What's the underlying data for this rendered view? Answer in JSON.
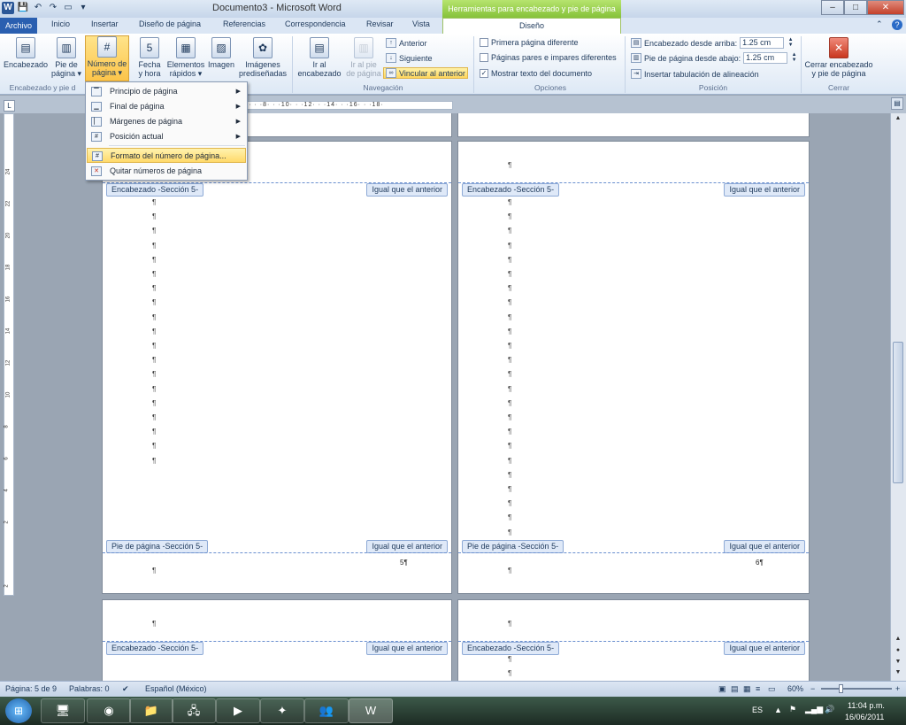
{
  "window": {
    "title": "Documento3 - Microsoft Word",
    "context_tab": "Herramientas para encabezado y pie de página",
    "minimize": "–",
    "maximize": "□",
    "close": "✕",
    "qa_icons": {
      "word": "W",
      "save": "💾",
      "undo": "↶",
      "redo": "↷",
      "print": "▭",
      "custom": "▾"
    }
  },
  "tabs": {
    "archivo": "Archivo",
    "inicio": "Inicio",
    "insertar": "Insertar",
    "diseno_pagina": "Diseño de página",
    "referencias": "Referencias",
    "correspondencia": "Correspondencia",
    "revisar": "Revisar",
    "vista": "Vista",
    "diseno": "Diseño",
    "minimize_ribbon": "⌃",
    "help": "?"
  },
  "ribbon": {
    "encabezado": "Encabezado",
    "pie_pagina_1": "Pie de",
    "pie_pagina_2": "página ▾",
    "numero_pagina_1": "Número de",
    "numero_pagina_2": "página ▾",
    "fecha_1": "Fecha",
    "fecha_2": "y hora",
    "elementos_1": "Elementos",
    "elementos_2": "rápidos ▾",
    "imagen": "Imagen",
    "imagenes_pred_1": "Imágenes",
    "imagenes_pred_2": "prediseñadas",
    "ir_encabezado_1": "Ir al",
    "ir_encabezado_2": "encabezado",
    "ir_pie_1": "Ir al pie",
    "ir_pie_2": "de página",
    "anterior": "Anterior",
    "siguiente": "Siguiente",
    "vincular": "Vincular al anterior",
    "primera_pagina": "Primera página diferente",
    "pares_impares": "Páginas pares e impares diferentes",
    "mostrar_texto": "Mostrar texto del documento",
    "enc_arriba_label": "Encabezado desde arriba:",
    "enc_arriba_value": "1.25 cm",
    "pie_abajo_label": "Pie de página desde abajo:",
    "pie_abajo_value": "1.25 cm",
    "tab_alineacion": "Insertar tabulación de alineación",
    "cerrar_1": "Cerrar encabezado",
    "cerrar_2": "y pie de página",
    "groups": {
      "encabezado": "Encabezado y pie d",
      "navegacion": "Navegación",
      "opciones": "Opciones",
      "posicion": "Posición",
      "cerrar": "Cerrar"
    },
    "checks": {
      "primera": false,
      "pares": false,
      "mostrar": true
    }
  },
  "menu": {
    "items": [
      {
        "label": "Principio de página",
        "submenu": true
      },
      {
        "label": "Final de página",
        "submenu": true
      },
      {
        "label": "Márgenes de página",
        "submenu": true
      },
      {
        "label": "Posición actual",
        "submenu": true
      },
      {
        "label": "Formato del número de página...",
        "submenu": false
      },
      {
        "label": "Quitar números de página",
        "submenu": false
      }
    ]
  },
  "ruler": {
    "horizontal": "·5·  · ·8·  · ·10· ·  ·12·  · ·14· ·  ·16·  · ·18·",
    "vertical": [
      "24",
      "22",
      "20",
      "18",
      "16",
      "14",
      "12",
      "10",
      "8",
      "6",
      "4",
      "2",
      "2"
    ]
  },
  "pages": {
    "header_tag": "Encabezado -Sección 5-",
    "footer_tag": "Pie de página -Sección 5-",
    "same_as_previous": "Igual que el anterior",
    "pilcrow": "¶",
    "page5_number": "5¶",
    "page6_number": "6¶"
  },
  "status": {
    "page": "Página: 5 de 9",
    "words": "Palabras: 0",
    "language": "Español (México)",
    "zoom": "60%",
    "zoom_minus": "−",
    "zoom_plus": "+"
  },
  "taskbar": {
    "language": "ES",
    "time": "11:04 p.m.",
    "date": "16/06/2011"
  }
}
